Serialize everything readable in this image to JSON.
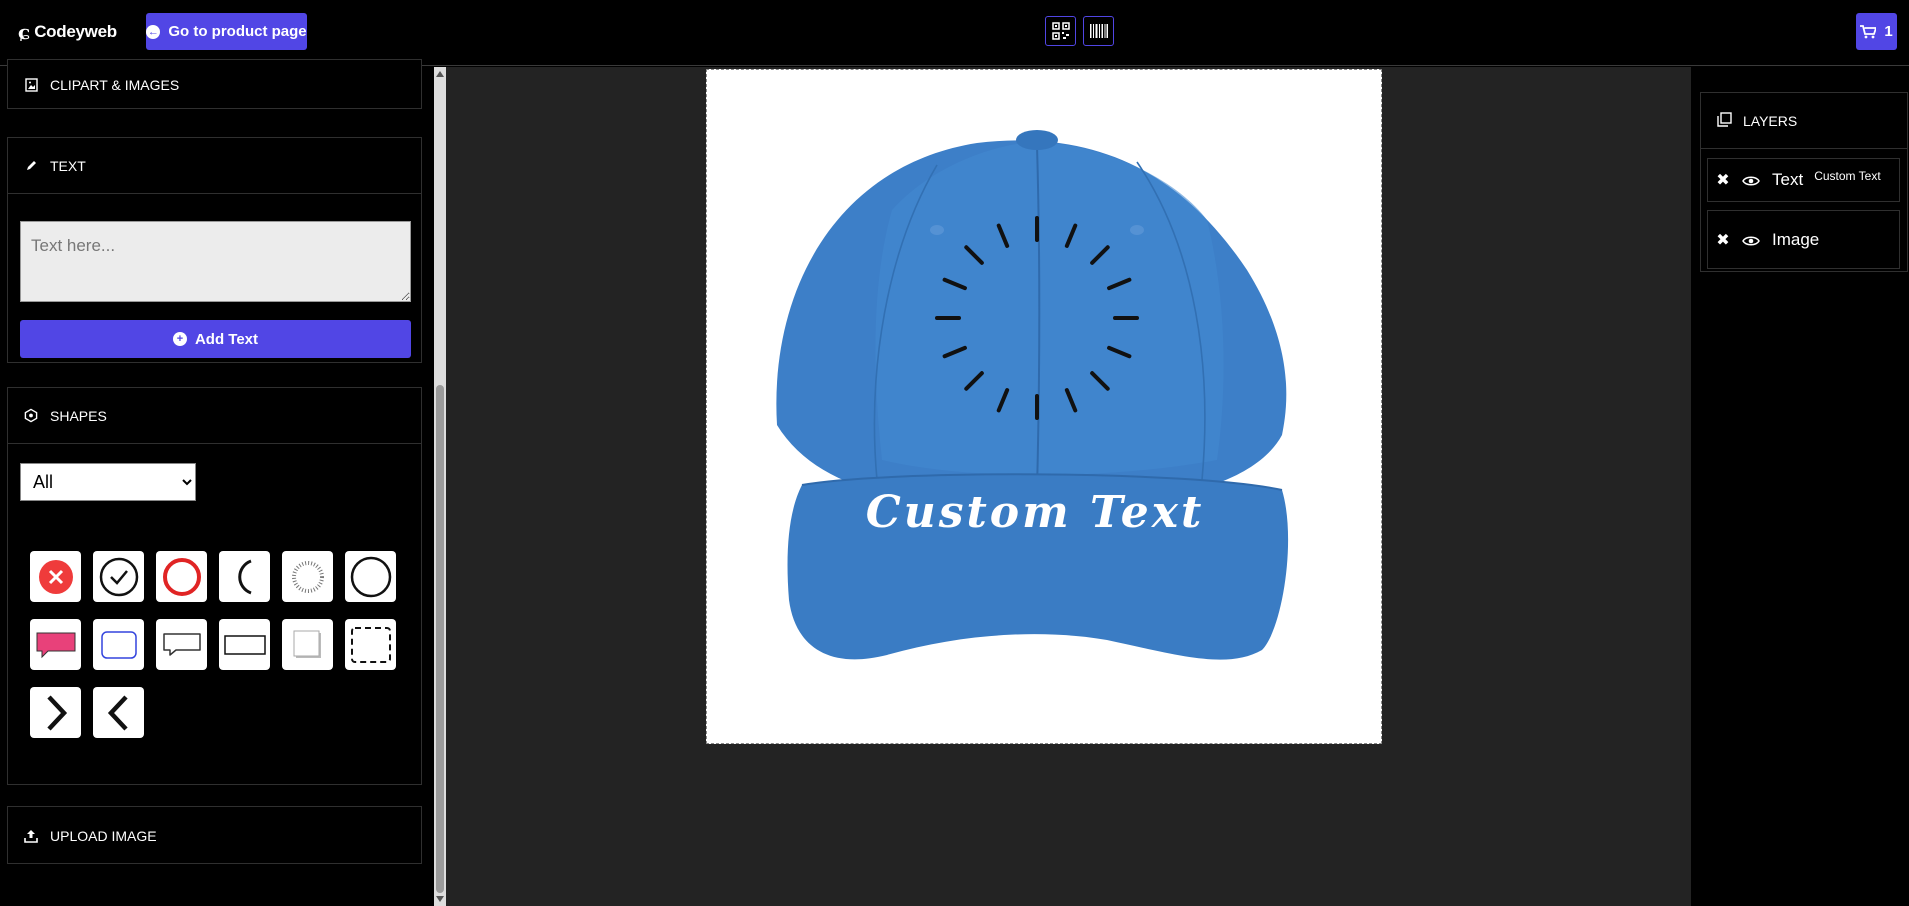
{
  "header": {
    "logo_text": "Codeyweb",
    "go_product_label": "Go to product page",
    "qr_icon": "qr-code-icon",
    "barcode_icon": "barcode-icon",
    "cart_count": "1"
  },
  "sidebar": {
    "clipart_title": "CLIPART & IMAGES",
    "text_title": "TEXT",
    "text_placeholder": "Text here...",
    "add_text_label": "Add Text",
    "shapes_title": "SHAPES",
    "shape_filter_value": "All",
    "upload_title": "UPLOAD IMAGE",
    "shapes": [
      "close-circle-shape",
      "check-circle-shape",
      "red-ring-shape",
      "arc-shape",
      "dotted-circle-shape",
      "circle-outline-shape",
      "pink-speech-bubble-shape",
      "blue-rounded-rect-shape",
      "speech-bubble-outline-shape",
      "rectangle-outline-shape",
      "shadow-square-shape",
      "dashed-rect-shape",
      "chevron-right-shape",
      "chevron-left-shape"
    ]
  },
  "canvas": {
    "product": "blue baseball cap",
    "cap_color": "#3d7fc8",
    "custom_text": "Custom Text"
  },
  "layers": {
    "title": "LAYERS",
    "items": [
      {
        "label": "Text",
        "sub": "Custom Text"
      },
      {
        "label": "Image",
        "sub": ""
      }
    ]
  },
  "colors": {
    "accent": "#5146e5",
    "panel_bg": "#000000",
    "workspace_bg": "#232323"
  }
}
